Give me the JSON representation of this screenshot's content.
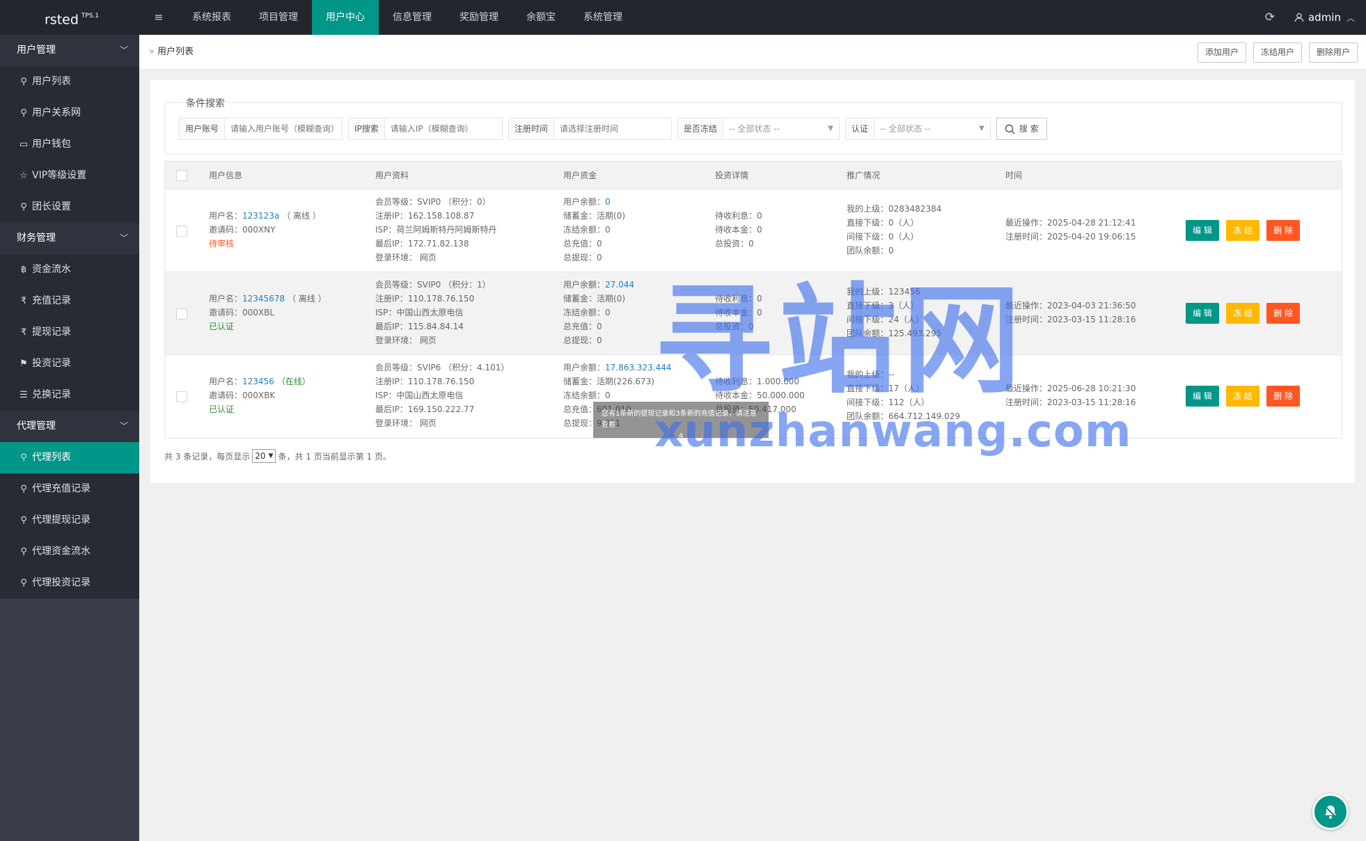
{
  "app": {
    "logo": "rsted",
    "logo_version": "TPS.1",
    "menu_icon": "≡",
    "refresh_icon": "⟳",
    "admin": "admin"
  },
  "topnav": [
    "系统报表",
    "项目管理",
    "用户中心",
    "信息管理",
    "奖励管理",
    "余额宝",
    "系统管理"
  ],
  "sidebar": {
    "groups": [
      {
        "label": "用户管理",
        "items": [
          {
            "icon": "user-icon",
            "label": "用户列表"
          },
          {
            "icon": "user-icon",
            "label": "用户关系网"
          },
          {
            "icon": "wallet-icon",
            "label": "用户钱包"
          },
          {
            "icon": "star-icon",
            "label": "VIP等级设置"
          },
          {
            "icon": "user-icon",
            "label": "团长设置"
          }
        ]
      },
      {
        "label": "财务管理",
        "items": [
          {
            "icon": "bitcoin-icon",
            "label": "资金流水"
          },
          {
            "icon": "rupee-icon",
            "label": "充值记录"
          },
          {
            "icon": "rupee-icon",
            "label": "提现记录"
          },
          {
            "icon": "flag-icon",
            "label": "投资记录"
          },
          {
            "icon": "list-icon",
            "label": "兑换记录"
          }
        ]
      },
      {
        "label": "代理管理",
        "items": [
          {
            "icon": "user-icon",
            "label": "代理列表"
          },
          {
            "icon": "user-icon",
            "label": "代理充值记录"
          },
          {
            "icon": "user-icon",
            "label": "代理提现记录"
          },
          {
            "icon": "user-icon",
            "label": "代理资金流水"
          },
          {
            "icon": "user-icon",
            "label": "代理投资记录"
          }
        ]
      }
    ]
  },
  "breadcrumb": "用户列表",
  "header_actions": [
    "添加用户",
    "冻结用户",
    "删除用户"
  ],
  "search": {
    "legend": "条件搜索",
    "account_label": "用户账号",
    "account_placeholder": "请输入用户账号（模糊查询）",
    "ip_label": "IP搜索",
    "ip_placeholder": "请输入IP（模糊查询）",
    "time_label": "注册时间",
    "time_placeholder": "请选择注册时间",
    "frozen_label": "是否冻结",
    "frozen_value": "-- 全部状态 --",
    "auth_label": "认证",
    "auth_value": "-- 全部状态 --",
    "button": "搜 索"
  },
  "table": {
    "headers": [
      "用户信息",
      "用户资料",
      "用户资金",
      "投资详情",
      "推广情况",
      "时间"
    ],
    "rows": [
      {
        "username_label": "用户名：",
        "username": "123123a",
        "online": "（ 离线 ）",
        "invite": "邀请码：000XNY",
        "status": "待审核",
        "status_type": "pending",
        "profile": [
          "会员等级：SVIP0 （积分：0）",
          "注册IP：162.158.108.87",
          "ISP：荷兰阿姆斯特丹阿姆斯特丹",
          "最后IP：172.71.82.138",
          "登录环境： 网页"
        ],
        "balance_label": "用户余额：",
        "balance": "0",
        "funds": [
          "储蓄金：活期(0)",
          "冻结余额：0",
          "总充值：0",
          "总提现：0"
        ],
        "invest": [
          "待收利息：0",
          "待收本金：0",
          "总投资：0"
        ],
        "promo": [
          "我的上级：0283482384",
          "直接下级：0（人）",
          "间接下级：0（人）",
          "团队余额：0"
        ],
        "time": [
          "最近操作：2025-04-28 21:12:41",
          "注册时间：2025-04-20 19:06:15"
        ]
      },
      {
        "username_label": "用户名：",
        "username": "12345678",
        "online": "（ 离线 ）",
        "invite": "邀请码：000XBL",
        "status": "已认证",
        "status_type": "ok",
        "profile": [
          "会员等级：SVIP0 （积分：1）",
          "注册IP：110.178.76.150",
          "ISP：中国山西太原电信",
          "最后IP：115.84.84.14",
          "登录环境： 网页"
        ],
        "balance_label": "用户余额：",
        "balance": "27.044",
        "funds": [
          "储蓄金：活期(0)",
          "冻结余额：0",
          "总充值：0",
          "总提现：0"
        ],
        "invest": [
          "待收利息：0",
          "待收本金：0",
          "总投资：0"
        ],
        "promo": [
          "我的上级：123456",
          "直接下级：3（人）",
          "间接下级：24（人）",
          "团队余额：125.493.295"
        ],
        "time": [
          "最近操作：2023-04-03 21:36:50",
          "注册时间：2023-03-15 11:28:16"
        ]
      },
      {
        "username_label": "用户名：",
        "username": "123456",
        "online": "（在线）",
        "invite": "邀请码：000XBK",
        "status": "已认证",
        "status_type": "ok",
        "profile": [
          "会员等级：SVIP6 （积分：4.101）",
          "注册IP：110.178.76.150",
          "ISP：中国山西太原电信",
          "最后IP：169.150.222.77",
          "登录环境： 网页"
        ],
        "balance_label": "用户余额：",
        "balance": "17.863.323.444",
        "funds": [
          "储蓄金：活期(226.673)",
          "冻结余额：0",
          "总充值：601.010",
          "总提现：9.851"
        ],
        "invest": [
          "待收利息：1.000.000",
          "待收本金：50.000.000",
          "总投资：50.417.000"
        ],
        "promo": [
          "我的上级：--",
          "直接下级：17（人）",
          "间接下级：112（人）",
          "团队余额：664.712.149.029"
        ],
        "time": [
          "最近操作：2025-06-28 10:21:30",
          "注册时间：2023-03-15 11:28:16"
        ]
      }
    ],
    "actions": {
      "edit": "编 辑",
      "freeze": "冻 结",
      "delete": "删 除"
    }
  },
  "pager": {
    "prefix": "共 3 条记录，每页显示",
    "page_size": "20",
    "suffix": "条，共 1 页当前显示第 1 页。"
  },
  "toast": {
    "line1": "您有1条新的提现记录和3条新的充值记录，请注意查看",
    "line2": "4"
  },
  "watermark": {
    "cn": "寻站网",
    "en": "xunzhanwang.com"
  },
  "colors": {
    "accent": "#009688",
    "warn": "#ffb800",
    "danger": "#ff5722",
    "dark": "#23262e"
  }
}
